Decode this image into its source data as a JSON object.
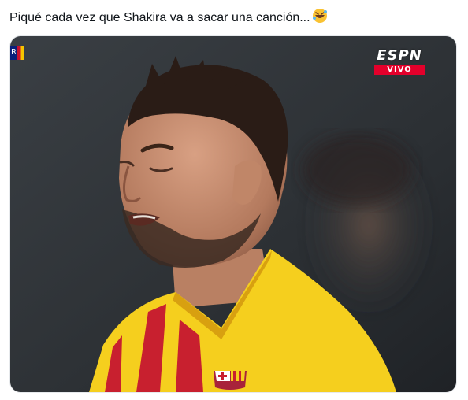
{
  "post": {
    "text": "Piqué cada vez que Shakira va a sacar una canción...",
    "emoji": "rolling-on-floor-laughing-emoji"
  },
  "media": {
    "broadcaster": "ESPN",
    "live_label": "VIVO",
    "corner_label": "R",
    "colors": {
      "espn_red": "#e4002b",
      "jersey_yellow": "#f5cf1e",
      "jersey_stripe": "#c8202f"
    }
  }
}
